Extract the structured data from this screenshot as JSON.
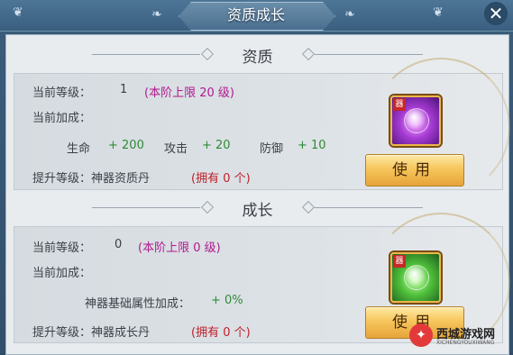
{
  "window": {
    "title": "资质成长"
  },
  "aptitude": {
    "heading": "资质",
    "current_level_label": "当前等级：",
    "current_level_value": "1",
    "level_cap": "(本阶上限 20 级)",
    "bonus_label": "当前加成：",
    "stats": [
      {
        "name": "生命",
        "value": "+ 200"
      },
      {
        "name": "攻击",
        "value": "+ 20"
      },
      {
        "name": "防御",
        "value": "+ 10"
      }
    ],
    "upgrade_label": "提升等级：神器资质丹",
    "owned": "(拥有 0 个)",
    "item_badge": "器",
    "use_label": "使用"
  },
  "growth": {
    "heading": "成长",
    "current_level_label": "当前等级：",
    "current_level_value": "0",
    "level_cap": "(本阶上限 0 级)",
    "bonus_label": "当前加成：",
    "attr_label": "神器基础属性加成：",
    "attr_value": "+ 0%",
    "upgrade_label": "提升等级：神器成长丹",
    "owned": "(拥有 0 个)",
    "item_badge": "器",
    "use_label": "使用"
  },
  "watermark": {
    "name": "西城游戏网",
    "sub": "XICHENGYOUXIWANG"
  },
  "colors": {
    "accent_magenta": "#b11a8e",
    "stat_green": "#2f8a37",
    "owned_red": "#c0202a",
    "button_gold": "#f6c65c"
  }
}
